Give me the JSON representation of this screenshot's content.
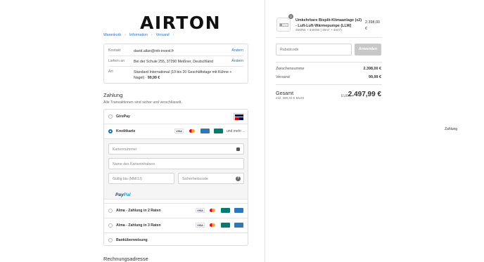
{
  "brand": {
    "logo_text": "AIRTON"
  },
  "breadcrumb": {
    "items": [
      "Warenkorb",
      "Information",
      "Versand",
      "Zahlung"
    ]
  },
  "info": {
    "rows": [
      {
        "key": "Kontakt",
        "value": "david.allan@mh-invest.fr",
        "change": "Ändern"
      },
      {
        "key": "Liefern an",
        "value": "Bei der Schule 255, 37290 Meißner, Deutschland",
        "change": "Ändern"
      },
      {
        "key": "Art",
        "value": "Standard International (10 bis 20 Geschäftstage mit Kühne + Nagel) ·",
        "price": "99,99 €"
      }
    ]
  },
  "payment": {
    "title": "Zahlung",
    "subtitle": "Alle Transaktionen sind sicher und verschlüsselt.",
    "options": [
      {
        "label": "GiroPay",
        "selected": false
      },
      {
        "label": "Kreditkarte",
        "selected": true,
        "more": "und mehr ..."
      },
      {
        "label": "Alma - Zahlung in 2 Raten",
        "selected": false
      },
      {
        "label": "Alma - Zahlung in 3 Raten",
        "selected": false
      },
      {
        "label": "Banküberweisung",
        "selected": false
      }
    ],
    "card_fields": {
      "number": "Kartennummer",
      "name": "Name des Karteninhabers",
      "expiry": "Gültig bis (MM/JJ)",
      "cvc": "Sicherheitscode"
    },
    "paypal": {
      "pay": "Pay",
      "pal": "Pal"
    },
    "card_brands": [
      "VISA",
      "mastercard",
      "AMEX",
      "CB"
    ]
  },
  "billing": {
    "title": "Rechnungsadresse"
  },
  "order": {
    "quantity": "2",
    "product_name": "Umkehrbare Bisplit-Klimaanlage (x2) - Luft-Luft-Wärmepumpe (LLW)",
    "variant": "2500W + 3400W | 30m² + 45m²)",
    "price": "2.398,00 €",
    "discount_placeholder": "Rabattcode",
    "apply_label": "Anwenden",
    "subtotal_label": "Zwischensumme",
    "subtotal_value": "2.398,00 €",
    "shipping_label": "Versand",
    "shipping_value": "99,99 €",
    "total_label": "Gesamt",
    "tax_note": "inkl. 398,83 € MwSt",
    "currency": "EUR",
    "total_value": "2.497,99 €"
  },
  "colors": {
    "accent": "#1773b0",
    "link": "#2a6ebb",
    "button_disabled": "#c8c8c8"
  }
}
